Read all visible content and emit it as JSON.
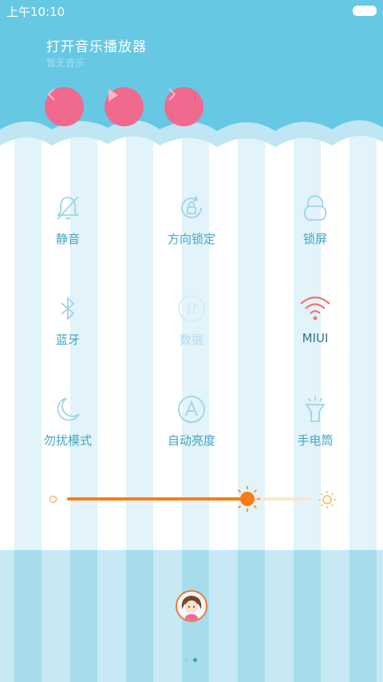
{
  "status_bar": {
    "time": "上午10:10"
  },
  "music": {
    "title": "打开音乐播放器",
    "subtitle": "暂无音乐",
    "controls": [
      "previous-icon",
      "play-icon",
      "next-icon"
    ]
  },
  "toggles": [
    {
      "label": "静音",
      "icon": "bell-mute-icon",
      "state": "off"
    },
    {
      "label": "方向锁定",
      "icon": "rotation-lock-icon",
      "state": "off"
    },
    {
      "label": "锁屏",
      "icon": "lock-icon",
      "state": "off"
    },
    {
      "label": "蓝牙",
      "icon": "bluetooth-icon",
      "state": "off"
    },
    {
      "label": "数据",
      "icon": "mobile-data-icon",
      "state": "disabled"
    },
    {
      "label": "MIUI",
      "icon": "wifi-icon",
      "state": "on"
    },
    {
      "label": "勿扰模式",
      "icon": "moon-icon",
      "state": "off"
    },
    {
      "label": "自动亮度",
      "icon": "auto-brightness-icon",
      "state": "off"
    },
    {
      "label": "手电筒",
      "icon": "flashlight-icon",
      "state": "off"
    }
  ],
  "brightness": {
    "level_percent": 74
  },
  "pager": {
    "pages": 2,
    "current": 2
  },
  "colors": {
    "header": "#67c8e3",
    "music_button": "#ef6a8d",
    "toggle_label": "#44a5c3",
    "wifi_active": "#f07575",
    "brightness": "#fb7c12"
  }
}
